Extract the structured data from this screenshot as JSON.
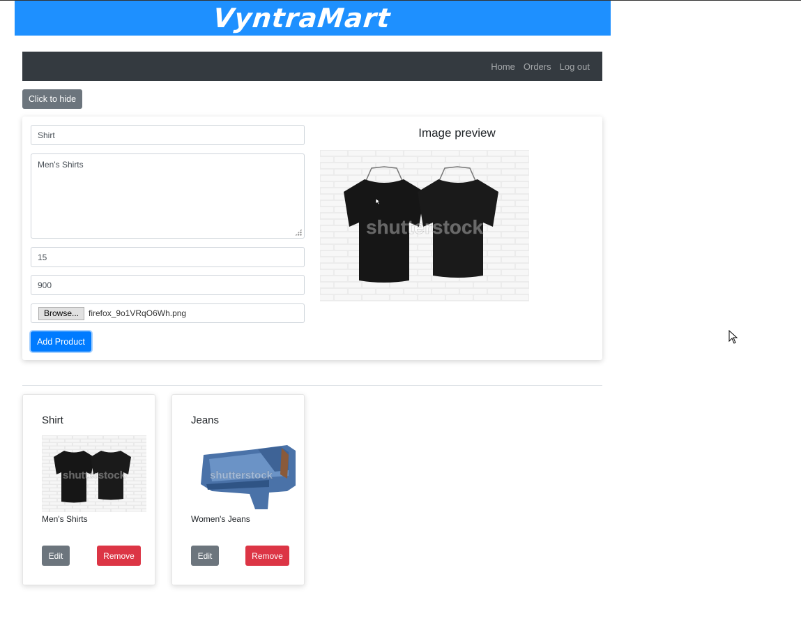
{
  "brand": {
    "title": "VyntraMart"
  },
  "nav": {
    "items": [
      "Home",
      "Orders",
      "Log out"
    ]
  },
  "toggle": {
    "hide_label": "Click to hide"
  },
  "form": {
    "name_value": "Shirt",
    "description_value": "Men's Shirts",
    "quantity_value": "15",
    "price_value": "900",
    "browse_label": "Browse...",
    "file_name": "firefox_9o1VRqO6Wh.png",
    "submit_label": "Add Product",
    "preview_title": "Image preview",
    "preview_watermark": "shutterstock"
  },
  "products": [
    {
      "name": "Shirt",
      "description": "Men's Shirts",
      "edit_label": "Edit",
      "remove_label": "Remove",
      "image_watermark": "shutterstock"
    },
    {
      "name": "Jeans",
      "description": "Women's Jeans",
      "edit_label": "Edit",
      "remove_label": "Remove",
      "image_watermark": "shutterstock"
    }
  ],
  "colors": {
    "banner": "#1e90ff",
    "navbar": "#343a40",
    "primary": "#007bff",
    "secondary": "#6c757d",
    "danger": "#dc3545"
  },
  "icons": {
    "cursor": "mouse-pointer-icon",
    "resize": "resize-grip-icon"
  }
}
